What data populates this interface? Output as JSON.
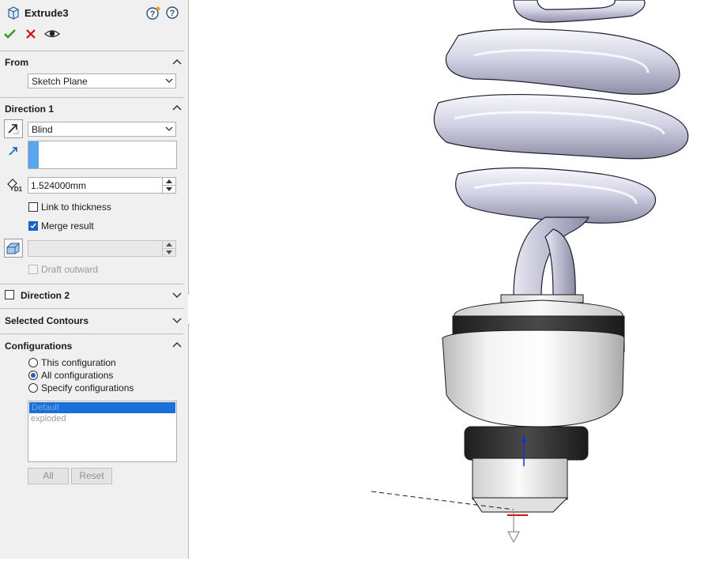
{
  "feature": {
    "title": "Extrude3"
  },
  "actions": {
    "ok": "OK",
    "cancel": "Cancel",
    "preview": "Preview"
  },
  "from": {
    "label": "From",
    "value": "Sketch Plane"
  },
  "direction1": {
    "label": "Direction 1",
    "end_condition": "Blind",
    "depth": "1.524000mm",
    "link_to_thickness": {
      "label": "Link to thickness",
      "checked": false
    },
    "merge_result": {
      "label": "Merge result",
      "checked": true
    },
    "draft_outward": {
      "label": "Draft outward",
      "checked": false,
      "enabled": false
    }
  },
  "direction2": {
    "label": "Direction 2",
    "checked": false
  },
  "selected_contours": {
    "label": "Selected Contours"
  },
  "configurations": {
    "label": "Configurations",
    "options": [
      {
        "label": "This configuration",
        "selected": false
      },
      {
        "label": "All configurations",
        "selected": true
      },
      {
        "label": "Specify configurations",
        "selected": false
      }
    ],
    "list": [
      {
        "name": "Default",
        "selected": true
      },
      {
        "name": "exploded",
        "selected": false
      }
    ],
    "buttons": {
      "all": "All",
      "reset": "Reset"
    }
  },
  "colors": {
    "accent": "#1a62c5",
    "ok_green": "#2a9a2a",
    "cancel_red": "#d01010",
    "selection_blue": "#5aa5f0"
  }
}
